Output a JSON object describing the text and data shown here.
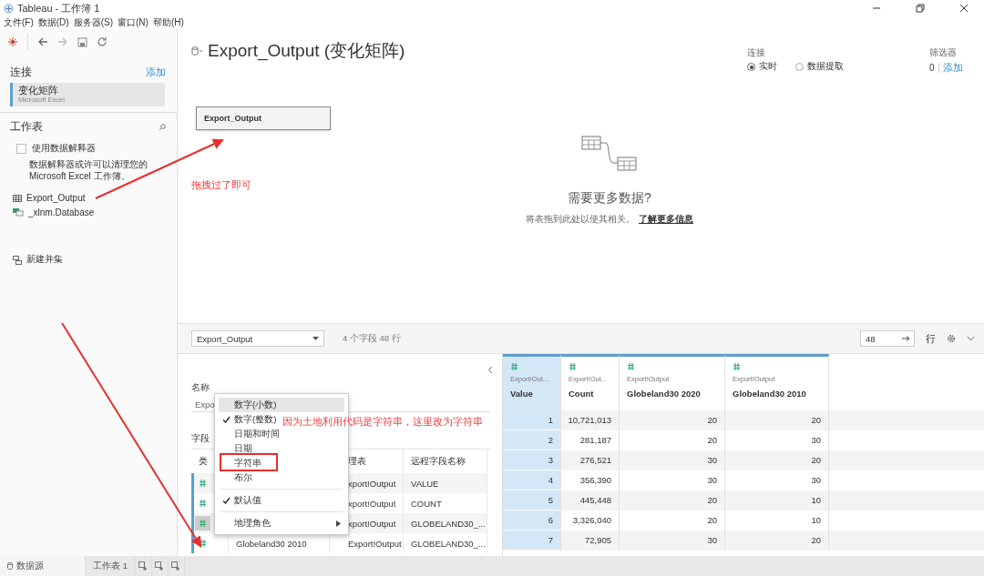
{
  "window": {
    "title": "Tableau - 工作簿 1"
  },
  "menu_bar": [
    "文件(F)",
    "数据(D)",
    "服务器(S)",
    "窗口(N)",
    "帮助(H)"
  ],
  "sidebar": {
    "connections_label": "连接",
    "add_link": "添加",
    "connections": [
      {
        "name": "变化矩阵",
        "type": "Microsoft Excel",
        "selected": true
      }
    ],
    "sheets_label": "工作表",
    "interpreter": {
      "label": "使用数据解释器",
      "checked": false,
      "description": "数据解释器或许可以清理您的 Microsoft Excel 工作簿。"
    },
    "sheets": [
      {
        "name": "Export_Output",
        "kind": "table"
      },
      {
        "name": "_xlnm.Database",
        "kind": "range"
      }
    ],
    "new_union": "新建并集"
  },
  "header": {
    "title": "Export_Output (变化矩阵)",
    "connection_label": "连接",
    "connection_modes": [
      {
        "label": "实时",
        "selected": true
      },
      {
        "label": "数据提取",
        "selected": false
      }
    ],
    "filters_label": "筛选器",
    "filters_count": "0",
    "filters_add": "添加"
  },
  "canvas": {
    "tables": [
      "Export_Output"
    ],
    "empty_title": "需要更多数据?",
    "empty_hint": "将表拖到此处以使其相关。",
    "learn_more": "了解更多信息"
  },
  "annotations": {
    "drag_note": "拖拽过了即可",
    "type_note": "因为土地利用代码是字符串，这里改为字符串"
  },
  "data_toolbar": {
    "table_select": "Export_Output",
    "summary": "4 个字段 48 行",
    "rows_value": "48",
    "rows_label": "行"
  },
  "metadata": {
    "name_label": "名称",
    "name_value": "Expo",
    "fields_label": "字段",
    "type_header": "类",
    "physical_header": "理表",
    "remote_header": "远程字段名称",
    "rows": [
      {
        "physical": "xport!Output",
        "remote": "VALUE",
        "selected": true,
        "hovered": false
      },
      {
        "physical": "xport!Output",
        "remote": "COUNT",
        "selected": true,
        "hovered": false
      },
      {
        "physical": "xport!Output",
        "remote": "GLOBELAND30_...",
        "selected": true,
        "hovered": true
      },
      {
        "field": "Globeland30 2010",
        "physical": "Export!Output",
        "remote": "GLOBELAND30_...",
        "selected": true,
        "hovered": false
      }
    ]
  },
  "context_menu": {
    "items": [
      {
        "kind": "item",
        "label": "数字(小数)",
        "checked": false,
        "selected": true
      },
      {
        "kind": "item",
        "label": "数字(整数)",
        "checked": true,
        "selected": false
      },
      {
        "kind": "item",
        "label": "日期和时间",
        "checked": false,
        "selected": false
      },
      {
        "kind": "item",
        "label": "日期",
        "checked": false,
        "selected": false
      },
      {
        "kind": "item",
        "label": "字符串",
        "checked": false,
        "selected": false
      },
      {
        "kind": "item",
        "label": "布尔",
        "checked": false,
        "selected": false
      },
      {
        "kind": "separator"
      },
      {
        "kind": "item",
        "label": "默认值",
        "checked": true,
        "selected": false
      },
      {
        "kind": "separator"
      },
      {
        "kind": "submenu",
        "label": "地理角色",
        "selected": false
      }
    ]
  },
  "grid": {
    "columns": [
      {
        "source": "Export!Out...",
        "name": "Value",
        "selected": true
      },
      {
        "source": "Export!Out...",
        "name": "Count",
        "selected": false
      },
      {
        "source": "Export!Output",
        "name": "Globeland30 2020",
        "selected": false
      },
      {
        "source": "Export!Output",
        "name": "Globeland30 2010",
        "selected": false
      }
    ],
    "rows": [
      [
        "1",
        "10,721,013",
        "20",
        "20"
      ],
      [
        "2",
        "281,187",
        "20",
        "30"
      ],
      [
        "3",
        "276,521",
        "30",
        "20"
      ],
      [
        "4",
        "356,390",
        "30",
        "30"
      ],
      [
        "5",
        "445,448",
        "20",
        "10"
      ],
      [
        "6",
        "3,326,040",
        "20",
        "10"
      ],
      [
        "7",
        "72,905",
        "30",
        "20"
      ]
    ]
  },
  "bottom_tabs": [
    {
      "label": "数据源",
      "kind": "datasource",
      "selected": true
    },
    {
      "label": "工作表 1",
      "kind": "sheet",
      "selected": false
    }
  ]
}
